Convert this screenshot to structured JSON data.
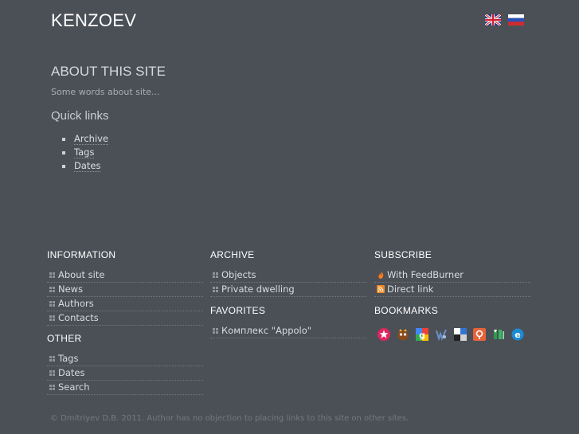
{
  "site": {
    "title": "KENZOEV",
    "languages": [
      "english-flag-icon",
      "russian-flag-icon"
    ]
  },
  "about": {
    "heading": "ABOUT THIS SITE",
    "text": "Some words about site...",
    "quick_links_heading": "Quick links",
    "quick_links": [
      "Archive",
      "Tags",
      "Dates"
    ]
  },
  "footer": {
    "information": {
      "heading": "INFORMATION",
      "items": [
        "About site",
        "News",
        "Authors",
        "Contacts"
      ]
    },
    "other": {
      "heading": "OTHER",
      "items": [
        "Tags",
        "Dates",
        "Search"
      ]
    },
    "archive": {
      "heading": "ARCHIVE",
      "items": [
        "Objects",
        "Private dwelling"
      ]
    },
    "favorites": {
      "heading": "FAVORITES",
      "items": [
        "Комплекс \"Appolo\""
      ]
    },
    "subscribe": {
      "heading": "SUBSCRIBE",
      "items": [
        {
          "label": "With FeedBurner",
          "icon": "feedburner-icon"
        },
        {
          "label": "Direct link",
          "icon": "rss-icon"
        }
      ]
    },
    "bookmarks": {
      "heading": "BOOKMARKS",
      "icons": [
        "bobrdobr-icon",
        "memori-icon",
        "google-bookmarks-icon",
        "vkontakte-icon",
        "delicious-icon",
        "moemesto-icon",
        "yandex-bookmarks-icon",
        "mister-wong-icon"
      ]
    },
    "copyright": "© Dmitriyev D.B. 2011. Author has no objection to placing links to this site on other sites."
  }
}
